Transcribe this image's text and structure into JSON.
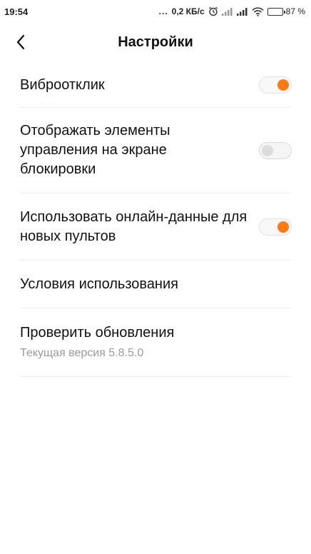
{
  "status_bar": {
    "time": "19:54",
    "dots": "...",
    "speed": "0,2 КБ/с",
    "battery": "87 %",
    "battery_level": 0.87,
    "icons": [
      "alarm-icon",
      "signal-icon",
      "signal-icon",
      "wifi-icon",
      "battery-icon"
    ]
  },
  "header": {
    "title": "Настройки",
    "back_icon": "chevron-left-icon"
  },
  "settings": {
    "vibro": {
      "title": "Виброотклик",
      "enabled": true
    },
    "lock_screen": {
      "title": "Отображать элементы управления на экране блокировки",
      "enabled": false
    },
    "online_data": {
      "title": "Использовать онлайн-данные для новых пультов",
      "enabled": true
    },
    "terms": {
      "title": "Условия использования"
    },
    "update": {
      "title": "Проверить обновления",
      "subtitle": "Текущая версия 5.8.5.0"
    }
  },
  "colors": {
    "accent": "#ff7a14",
    "toggle_off_knob": "#dcdcdc",
    "divider": "#ececec",
    "subtitle": "#9a9a9a"
  }
}
